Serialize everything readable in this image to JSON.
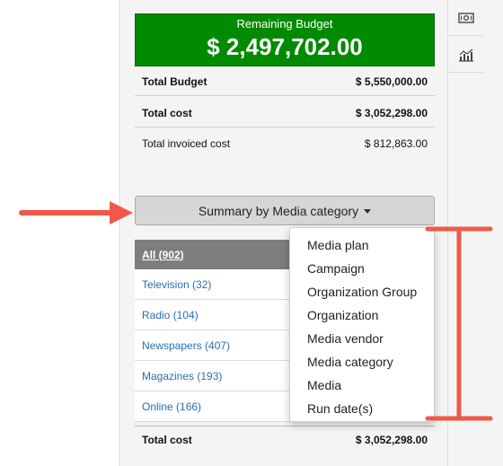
{
  "budget": {
    "title": "Remaining Budget",
    "amount": "$ 2,497,702.00"
  },
  "summary_lines": [
    {
      "label": "Total Budget",
      "value": "$ 5,550,000.00"
    },
    {
      "label": "Total cost",
      "value": "$ 3,052,298.00"
    },
    {
      "label": "Total invoiced cost",
      "value": "$ 812,863.00"
    }
  ],
  "summary_button": {
    "label": "Summary by Media category"
  },
  "table": {
    "header": "All (902)",
    "rows": [
      "Television (32)",
      "Radio (104)",
      "Newspapers (407)",
      "Magazines (193)",
      "Online (166)"
    ],
    "total_label": "Total cost",
    "total_value": "$ 3,052,298.00"
  },
  "dropdown": {
    "items": [
      "Media plan",
      "Campaign",
      "Organization Group",
      "Organization",
      "Media vendor",
      "Media category",
      "Media",
      "Run date(s)"
    ]
  },
  "rail_icons": [
    "money-icon",
    "chart-icon"
  ],
  "colors": {
    "budget_green": "#008a00",
    "link_blue": "#2a6db5",
    "annotation_red": "#f0594a",
    "header_gray": "#7d7d7d"
  }
}
